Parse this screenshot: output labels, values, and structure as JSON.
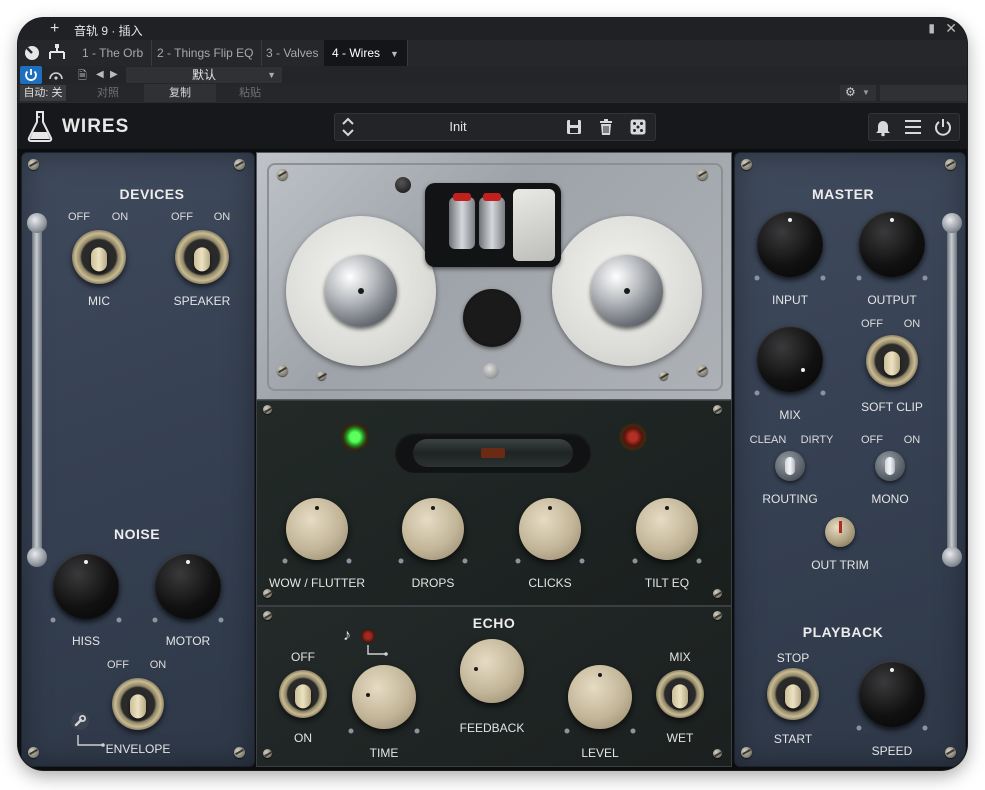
{
  "host": {
    "window_title": "音轨 9 · 插入",
    "tabs": [
      {
        "label": "1 - The Orb"
      },
      {
        "label": "2 - Things Flip EQ"
      },
      {
        "label": "3 - Valves"
      },
      {
        "label": "4 - Wires"
      }
    ],
    "host_preset": "默认",
    "auto_label": "自动: 关",
    "compare_label": "对照",
    "copy_label": "复制",
    "paste_label": "粘贴"
  },
  "plugin": {
    "brand": "WIRES",
    "preset_name": "Init",
    "icons": {
      "logo": "flask-icon",
      "save": "save-icon",
      "delete": "trash-icon",
      "random": "dice-icon",
      "bell": "bell-icon",
      "menu": "menu-icon",
      "power": "power-icon"
    }
  },
  "devices": {
    "title": "DEVICES",
    "mic": {
      "label": "MIC",
      "off": "OFF",
      "on": "ON"
    },
    "speaker": {
      "label": "SPEAKER",
      "off": "OFF",
      "on": "ON"
    }
  },
  "noise": {
    "title": "NOISE",
    "hiss_label": "HISS",
    "motor_label": "MOTOR",
    "envelope": {
      "label": "ENVELOPE",
      "off": "OFF",
      "on": "ON"
    }
  },
  "fx": {
    "wow_flutter_label": "WOW / FLUTTER",
    "drops_label": "DROPS",
    "clicks_label": "CLICKS",
    "tilt_eq_label": "TILT EQ"
  },
  "echo": {
    "title": "ECHO",
    "switch_off": "OFF",
    "switch_on": "ON",
    "time_label": "TIME",
    "feedback_label": "FEEDBACK",
    "level_label": "LEVEL",
    "mix_label": "MIX",
    "wet_label": "WET"
  },
  "master": {
    "title": "MASTER",
    "input_label": "INPUT",
    "output_label": "OUTPUT",
    "mix_label": "MIX",
    "soft_clip": {
      "label": "SOFT CLIP",
      "off": "OFF",
      "on": "ON"
    },
    "routing": {
      "label": "ROUTING",
      "left": "CLEAN",
      "right": "DIRTY"
    },
    "mono": {
      "label": "MONO",
      "off": "OFF",
      "on": "ON"
    },
    "out_trim_label": "OUT TRIM"
  },
  "playback": {
    "title": "PLAYBACK",
    "stop_label": "STOP",
    "start_label": "START",
    "speed_label": "SPEED"
  },
  "colors": {
    "panel_blue": "#3a4557",
    "accent_blue": "#1e6fbf",
    "green_led": "#4cff4c",
    "red_led": "#a11f18"
  }
}
